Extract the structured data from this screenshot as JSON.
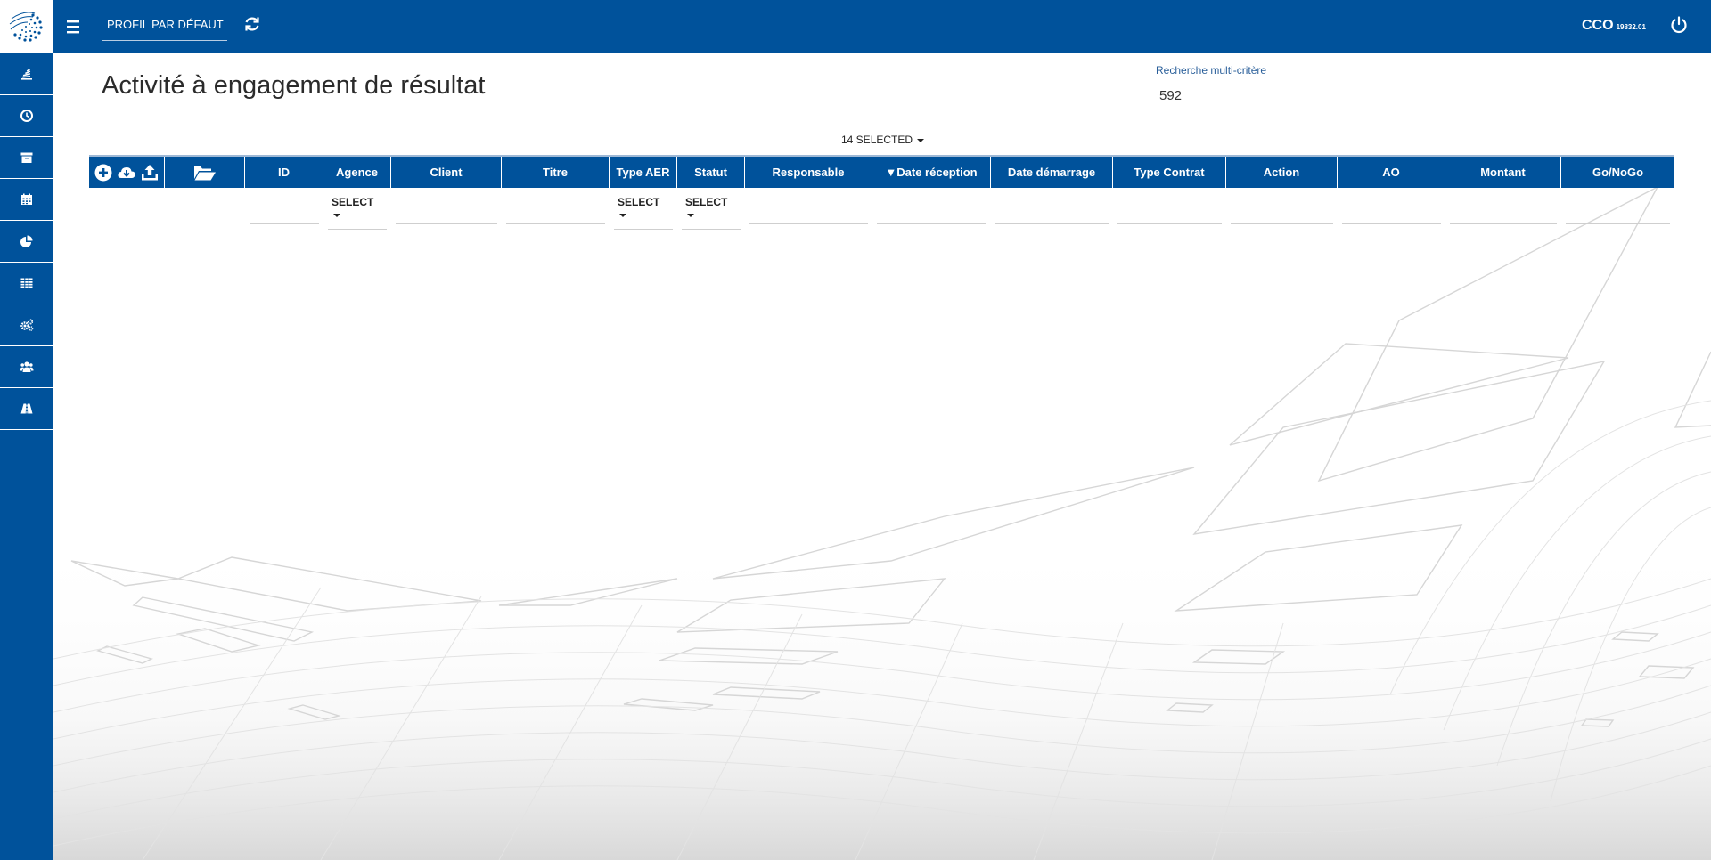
{
  "header": {
    "profile_label": "PROFIL PAR DÉFAUT",
    "user_name": "CCO",
    "user_code": "19832.01"
  },
  "page": {
    "title": "Activité à engagement de résultat"
  },
  "search": {
    "label": "Recherche multi-critère",
    "value": "592"
  },
  "columns_selector": {
    "label": "14 SELECTED"
  },
  "grid": {
    "columns": [
      "ID",
      "Agence",
      "Client",
      "Titre",
      "Type AER",
      "Statut",
      "Responsable",
      "▼Date réception",
      "Date démarrage",
      "Type Contrat",
      "Action",
      "AO",
      "Montant",
      "Go/NoGo"
    ],
    "filter_select_label": "SELECT"
  },
  "sidebar": {
    "items": [
      "stack-icon",
      "clock-icon",
      "archive-icon",
      "calendar-icon",
      "pie-chart-icon",
      "table-icon",
      "gears-icon",
      "users-icon",
      "road-icon"
    ]
  },
  "colors": {
    "primary": "#00529b",
    "background": "#ffffff"
  }
}
